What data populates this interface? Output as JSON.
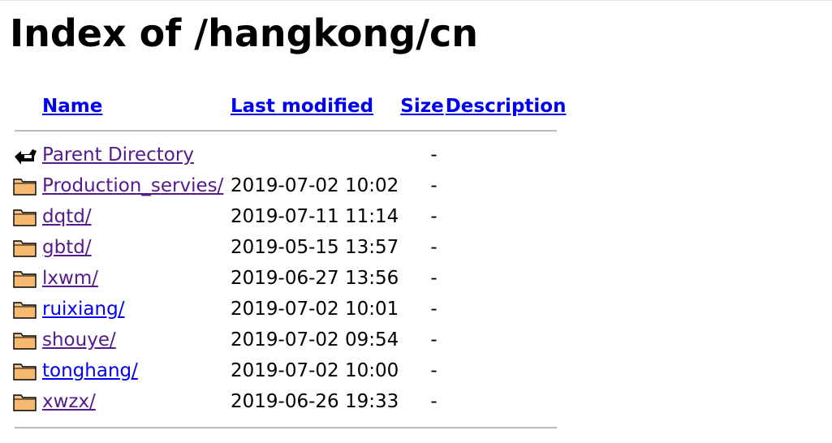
{
  "page": {
    "title": "Index of /hangkong/cn"
  },
  "table": {
    "headers": {
      "name": "Name",
      "last_modified": "Last modified",
      "size": "Size",
      "description": "Description"
    },
    "rows": [
      {
        "icon": "back-icon",
        "name": "Parent Directory",
        "date": "",
        "size": "-",
        "visited": true
      },
      {
        "icon": "folder-icon",
        "name": "Production_servies/",
        "date": "2019-07-02 10:02",
        "size": "-",
        "visited": true
      },
      {
        "icon": "folder-icon",
        "name": "dqtd/",
        "date": "2019-07-11 11:14",
        "size": "-",
        "visited": true
      },
      {
        "icon": "folder-icon",
        "name": "gbtd/",
        "date": "2019-05-15 13:57",
        "size": "-",
        "visited": true
      },
      {
        "icon": "folder-icon",
        "name": "lxwm/",
        "date": "2019-06-27 13:56",
        "size": "-",
        "visited": true
      },
      {
        "icon": "folder-icon",
        "name": "ruixiang/",
        "date": "2019-07-02 10:01",
        "size": "-",
        "visited": false
      },
      {
        "icon": "folder-icon",
        "name": "shouye/",
        "date": "2019-07-02 09:54",
        "size": "-",
        "visited": true
      },
      {
        "icon": "folder-icon",
        "name": "tonghang/",
        "date": "2019-07-02 10:00",
        "size": "-",
        "visited": false
      },
      {
        "icon": "folder-icon",
        "name": "xwzx/",
        "date": "2019-06-26 19:33",
        "size": "-",
        "visited": true
      }
    ]
  },
  "colors": {
    "link": "#0000ee",
    "visited": "#551a8b",
    "rule": "#a9a9a9"
  }
}
